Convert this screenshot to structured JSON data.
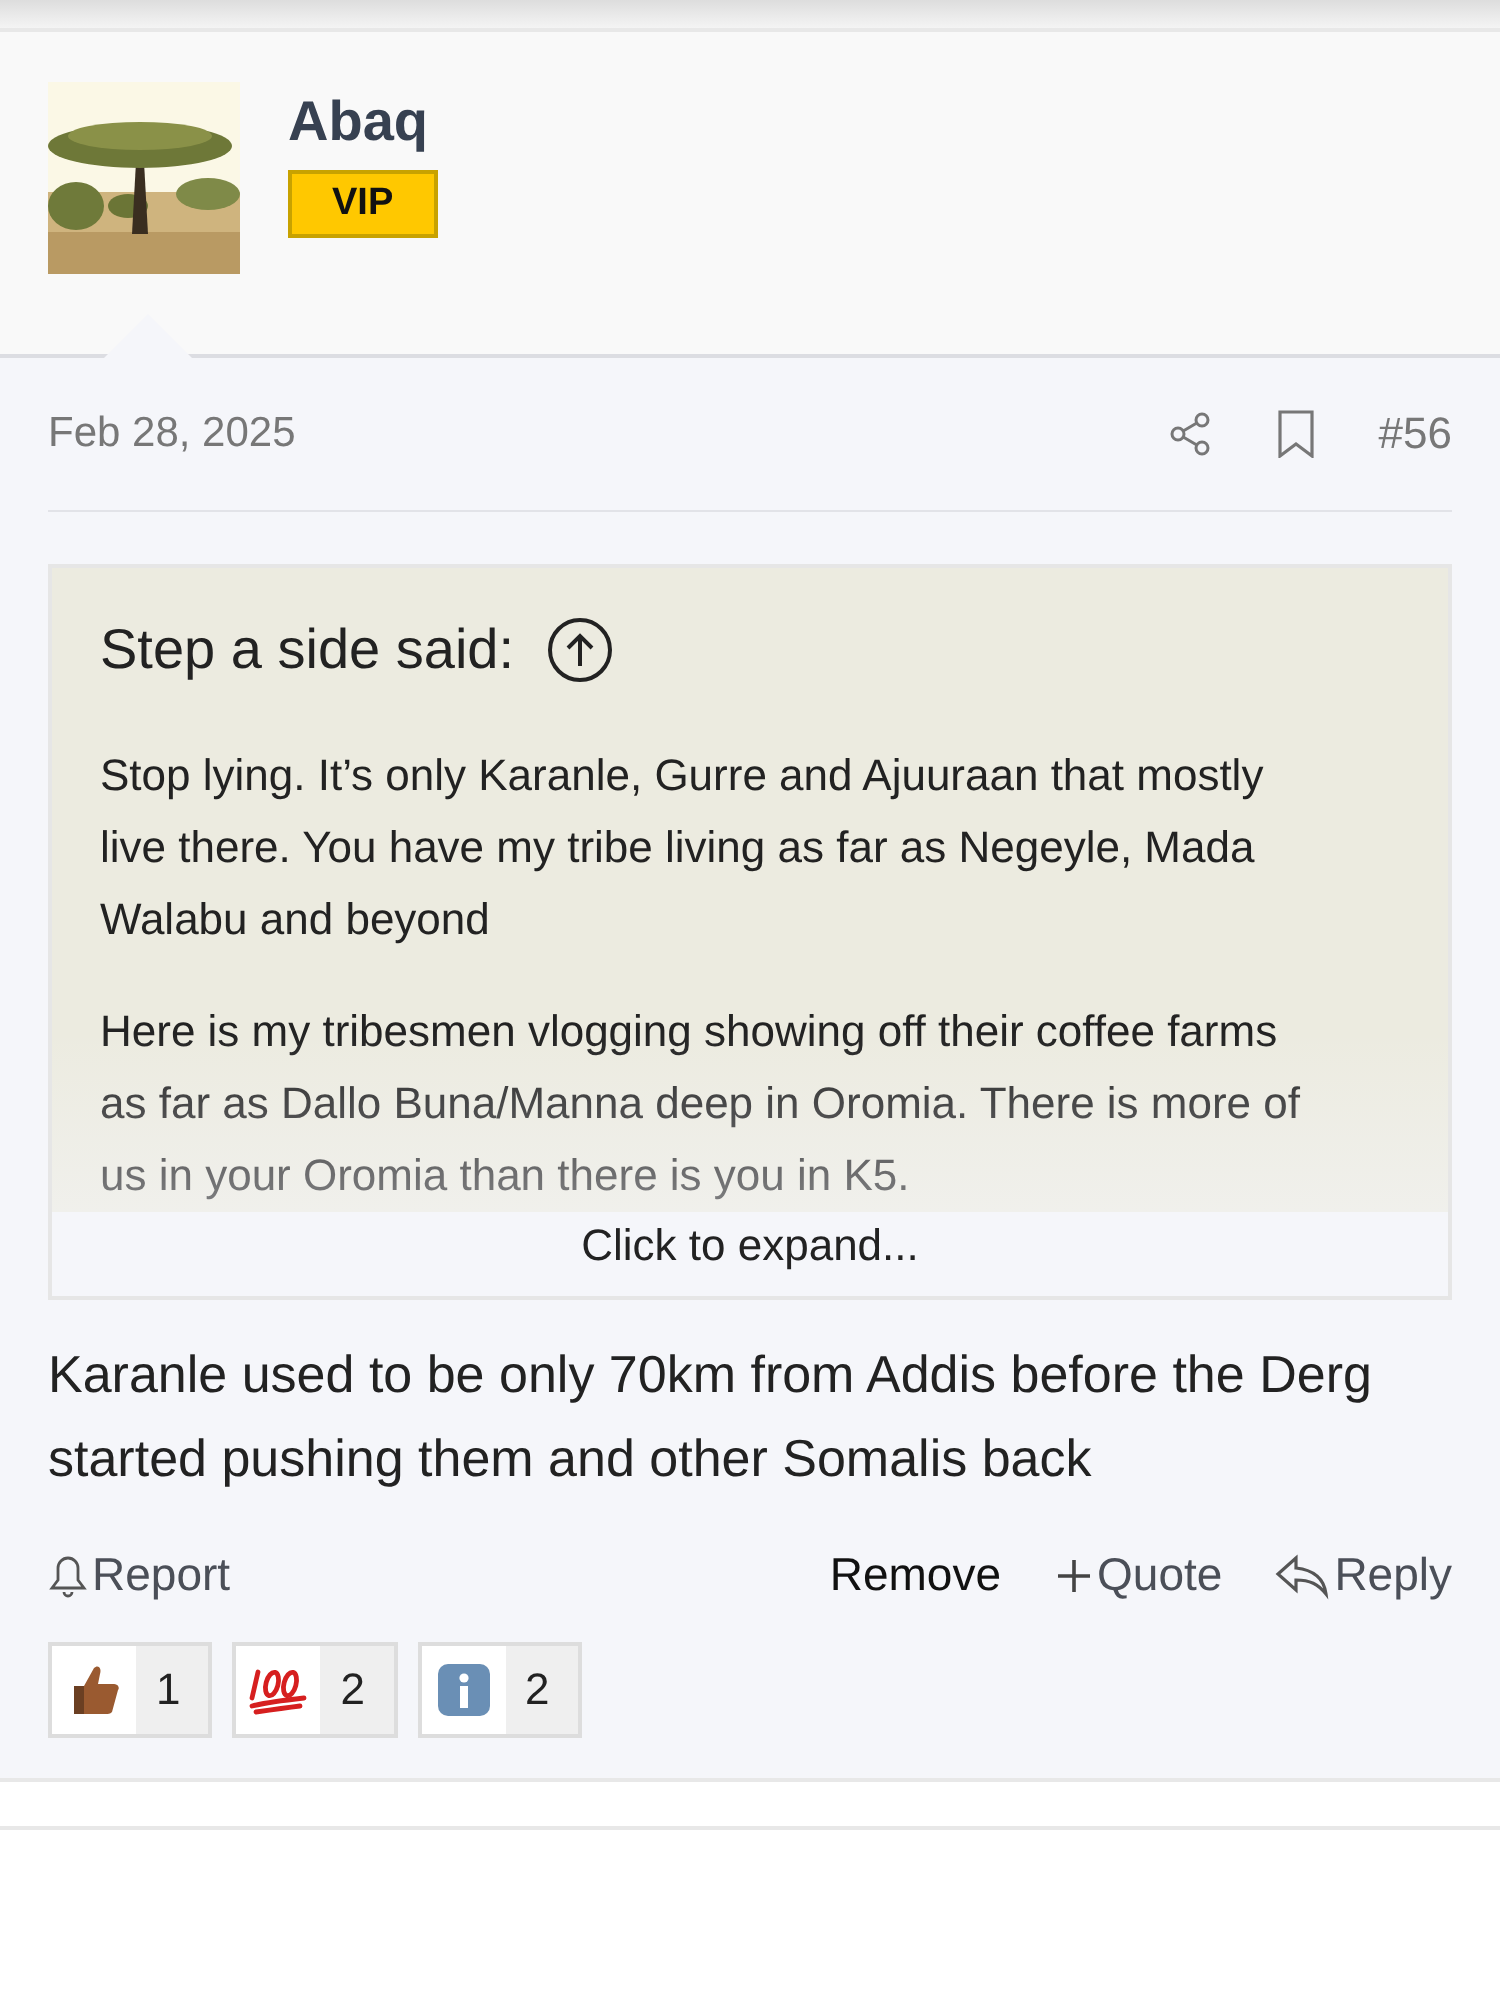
{
  "author": {
    "name": "Abaq",
    "badge": "VIP"
  },
  "post": {
    "date": "Feb 28, 2025",
    "number": "#56"
  },
  "quote": {
    "title": "Step a side said:",
    "paragraphs": [
      "Stop lying. It’s only Karanle, Gurre and Ajuuraan that mostly live there. You have my tribe living as far as Negeyle, Mada Walabu and beyond",
      "Here is my tribesmen vlogging showing off their coffee farms as far as Dallo Buna/Manna deep in Oromia. There is more of us in your Oromia than there is you in K5."
    ],
    "expand": "Click to expand..."
  },
  "body": "Karanle used to be only 70km from Addis before the Derg started pushing them and other Somalis back",
  "actions": {
    "report": "Report",
    "remove": "Remove",
    "quote": "Quote",
    "reply": "Reply"
  },
  "reactions": [
    {
      "kind": "thumbs",
      "count": "1"
    },
    {
      "kind": "hundred",
      "count": "2"
    },
    {
      "kind": "info",
      "count": "2"
    }
  ]
}
